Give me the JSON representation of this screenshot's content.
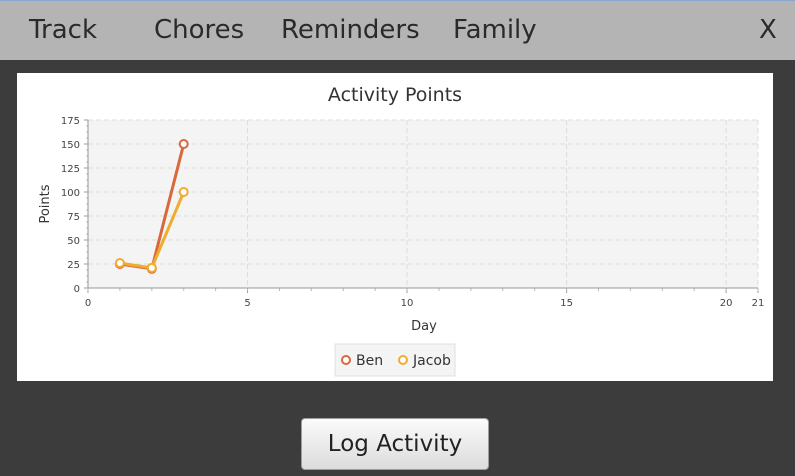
{
  "nav": {
    "track": "Track",
    "chores": "Chores",
    "reminders": "Reminders",
    "family": "Family",
    "close": "X"
  },
  "log_button": "Log Activity",
  "chart_data": {
    "type": "line",
    "title": "Activity Points",
    "xlabel": "Day",
    "ylabel": "Points",
    "xlim": [
      0,
      21
    ],
    "ylim": [
      0,
      175
    ],
    "xticks": [
      0,
      5,
      10,
      15,
      20,
      21
    ],
    "yticks": [
      0,
      25,
      50,
      75,
      100,
      125,
      150,
      175
    ],
    "grid": true,
    "legend": "bottom-center",
    "series": [
      {
        "name": "Ben",
        "color": "#d9683a",
        "points": [
          [
            1,
            25
          ],
          [
            2,
            20
          ],
          [
            3,
            150
          ]
        ]
      },
      {
        "name": "Jacob",
        "color": "#f0ac2e",
        "points": [
          [
            1,
            26
          ],
          [
            2,
            21
          ],
          [
            3,
            100
          ]
        ]
      }
    ]
  }
}
